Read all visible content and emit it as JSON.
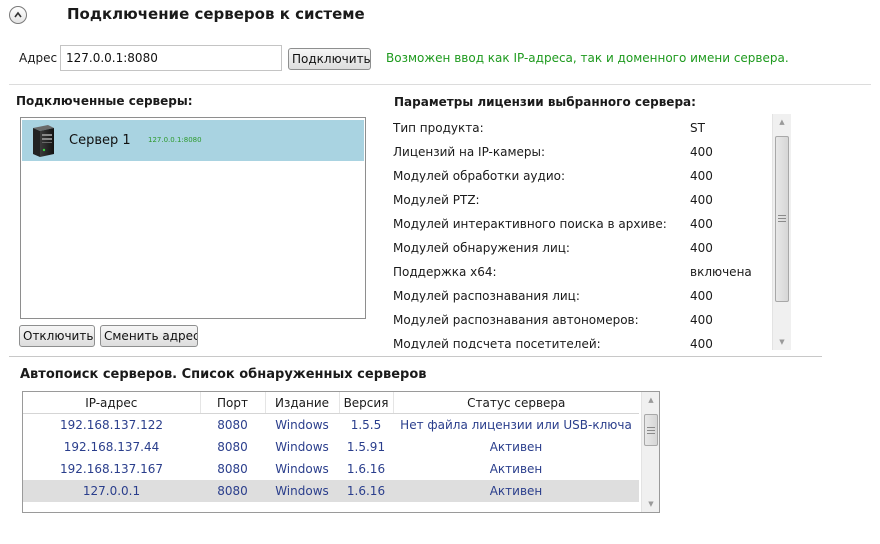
{
  "connect": {
    "title": "Подключение серверов к системе",
    "address_label": "Адрес",
    "address_value": "127.0.0.1:8080",
    "connect_button": "Подключить",
    "hint": "Возможен ввод как IP-адреса, так и доменного имени сервера."
  },
  "connected": {
    "title": "Подключенные серверы:",
    "servers": [
      {
        "name": "Сервер 1",
        "address": "127.0.0.1:8080",
        "selected": true
      }
    ],
    "disconnect_button": "Отключить",
    "change_address_button": "Сменить адрес"
  },
  "license": {
    "title": "Параметры лицензии выбранного сервера:",
    "rows": [
      {
        "label": "Тип продукта:",
        "value": "ST"
      },
      {
        "label": "Лицензий на IP-камеры:",
        "value": "400"
      },
      {
        "label": "Модулей обработки аудио:",
        "value": "400"
      },
      {
        "label": "Модулей PTZ:",
        "value": "400"
      },
      {
        "label": "Модулей интерактивного поиска в архиве:",
        "value": "400"
      },
      {
        "label": "Модулей обнаружения лиц:",
        "value": "400"
      },
      {
        "label": "Поддержка x64:",
        "value": "включена"
      },
      {
        "label": "Модулей распознавания лиц:",
        "value": "400"
      },
      {
        "label": "Модулей распознавания автономеров:",
        "value": "400"
      },
      {
        "label": "Модулей подсчета посетителей:",
        "value": "400"
      }
    ]
  },
  "autosearch": {
    "title": "Автопоиск серверов. Список обнаруженных серверов",
    "columns": [
      "IP-адрес",
      "Порт",
      "Издание",
      "Версия",
      "Статус сервера"
    ],
    "rows": [
      {
        "ip": "192.168.137.122",
        "port": "8080",
        "edition": "Windows",
        "version": "1.5.5",
        "status": "Нет файла лицензии или USB-ключа",
        "selected": false
      },
      {
        "ip": "192.168.137.44",
        "port": "8080",
        "edition": "Windows",
        "version": "1.5.91",
        "status": "Активен",
        "selected": false
      },
      {
        "ip": "192.168.137.167",
        "port": "8080",
        "edition": "Windows",
        "version": "1.6.16",
        "status": "Активен",
        "selected": false
      },
      {
        "ip": "127.0.0.1",
        "port": "8080",
        "edition": "Windows",
        "version": "1.6.16",
        "status": "Активен",
        "selected": true
      }
    ]
  },
  "colors": {
    "hint": "#1e9a1e",
    "server_address": "#2e9a2e",
    "selection": "#a9d3e1",
    "table_text": "#2a3e8c"
  },
  "icons": {
    "collapse": "chevron-up-icon",
    "server": "server-tower-icon"
  }
}
